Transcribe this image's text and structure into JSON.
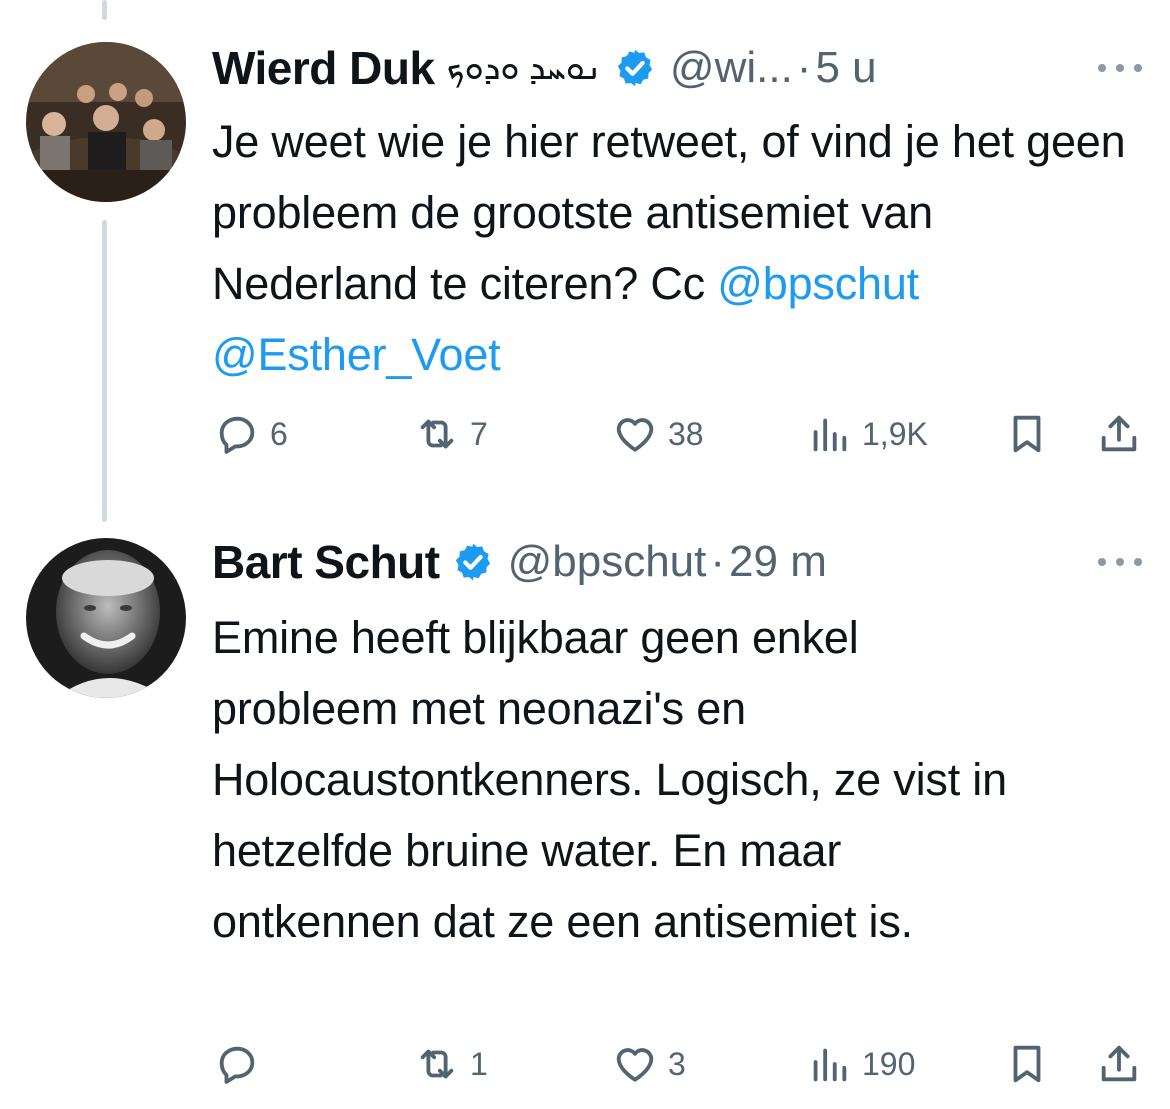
{
  "tweets": [
    {
      "display_name": "Wierd Duk",
      "name_extra": "ܢܘܚܕ ܘܕܘܟ",
      "handle": "@wi...",
      "separator": "·",
      "time": "5 u",
      "text_before": "Je weet wie je hier retweet, of vind je het geen probleem de grootste antisemiet van Nederland te citeren? Cc ",
      "mention_1": "@bpschut",
      "mention_2": "@Esther_Voet",
      "replies": "6",
      "retweets": "7",
      "likes": "38",
      "views": "1,9K"
    },
    {
      "display_name": "Bart Schut",
      "handle": "@bpschut",
      "separator": "·",
      "time": "29 m",
      "text": "Emine heeft blijkbaar geen enkel probleem met neonazi's en Holocaustontkenners. Logisch, ze vist in hetzelfde bruine water. En maar ontkennen dat ze een antisemiet is.",
      "replies": "",
      "retweets": "1",
      "likes": "3",
      "views": "190"
    }
  ],
  "colors": {
    "accent": "#1d9bf0",
    "secondary_text": "#536471",
    "primary_text": "#0f1419",
    "thread_line": "#cfd9de"
  },
  "icons": [
    "reply-icon",
    "retweet-icon",
    "like-icon",
    "views-icon",
    "bookmark-icon",
    "share-icon",
    "verified-badge-icon",
    "more-icon"
  ]
}
